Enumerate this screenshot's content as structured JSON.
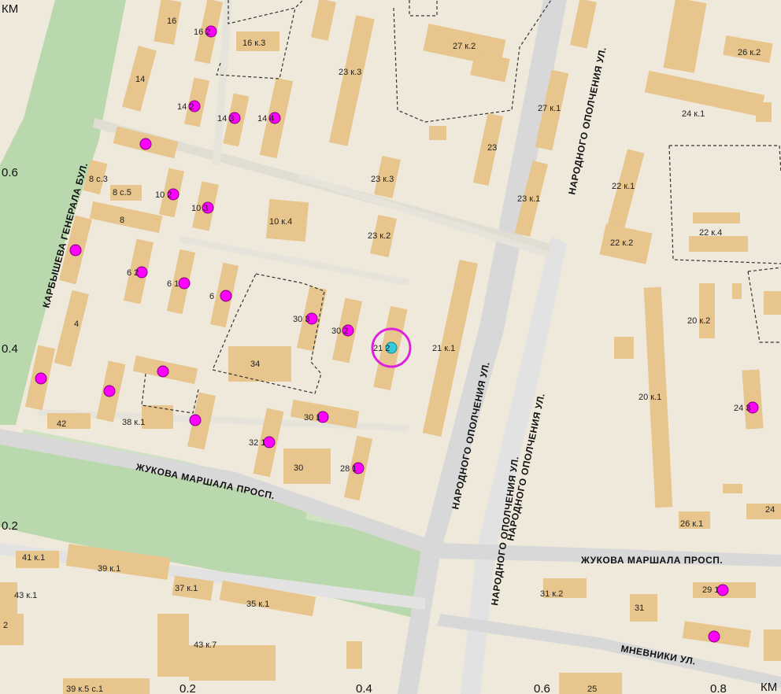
{
  "colors": {
    "background": "#efe9dc",
    "building": "#e7c58c",
    "park": "#b9d8ad",
    "road": "#d8d8d8",
    "marker": "#ff00ff",
    "selected": "#33ccdd",
    "boundary": "#333333"
  },
  "scale": {
    "top_left": "КМ",
    "bottom_right": "КМ",
    "left_06": "0.6",
    "left_04": "0.4",
    "left_02": "0.2",
    "bottom_02": "0.2",
    "bottom_04": "0.4",
    "bottom_06": "0.6",
    "bottom_08": "0.8"
  },
  "streets": {
    "karbysheva": "КАРБЫШЕВА ГЕНЕРАЛА БУЛ.",
    "zhukova_left": "ЖУКОВА МАРШАЛА ПРОСП.",
    "zhukova_right": "ЖУКОВА МАРШАЛА ПРОСП.",
    "opolcheniya_top": "НАРОДНОГО ОПОЛЧЕНИЯ УЛ.",
    "opolcheniya_mid": "НАРОДНОГО ОПОЛЧЕНИЯ УЛ.",
    "opolcheniya_right": "НАРОДНОГО ОПОЛЧЕНИЯ УЛ.",
    "opolcheniya_bottom": "НАРОДНОГО ОПОЛЧЕНИЯ УЛ.",
    "mnevniki": "МНЕВНИКИ УЛ."
  },
  "houses": {
    "h16": "16",
    "h16_2": "16 2",
    "h16k3": "16 к.3",
    "h14": "14",
    "h14_2": "14 2",
    "h14_3": "14 3",
    "h14_4": "14 4",
    "h23k3top": "23 к.3",
    "h27k2": "27 к.2",
    "h26k2": "26 к.2",
    "h27k1": "27 к.1",
    "h24k1": "24 к.1",
    "h23": "23",
    "h23k3": "23 к.3",
    "h23k1": "23 к.1",
    "h22k1": "22 к.1",
    "h22k4": "22 к.4",
    "h22k2": "22 к.2",
    "h8c3": "8 с.3",
    "h8c5": "8 с.5",
    "h10_2": "10 2",
    "h10_3": "10 3",
    "h10k4": "10 к.4",
    "h8": "8",
    "h23k2": "23 к.2",
    "h6_2": "6 2",
    "h6_1": "6 1",
    "h6": "6",
    "h30_3": "30 3",
    "h30_2": "30 2",
    "h21_2": "21 2",
    "h21k1": "21 к.1",
    "h20k2": "20 к.2",
    "h4": "4",
    "h34": "34",
    "h20k1": "20 к.1",
    "h24_3": "24 3",
    "h42": "42",
    "h38k1": "38 к.1",
    "h30_1": "30 1",
    "h32_1": "32 1",
    "h30": "30",
    "h28_1": "28 1",
    "h26k1": "26 к.1",
    "h24": "24",
    "h41k1": "41 к.1",
    "h39k1": "39 к.1",
    "h37k1": "37 к.1",
    "h43k1": "43 к.1",
    "h35k1": "35 к.1",
    "h31k2": "31 к.2",
    "h29_1": "29 1",
    "h31": "31",
    "h43k7": "43 к.7",
    "h2": "2",
    "h39k5": "39 к.5 с.1",
    "h25": "25"
  },
  "markers": {
    "count": 27,
    "selected_house": "21 2"
  }
}
